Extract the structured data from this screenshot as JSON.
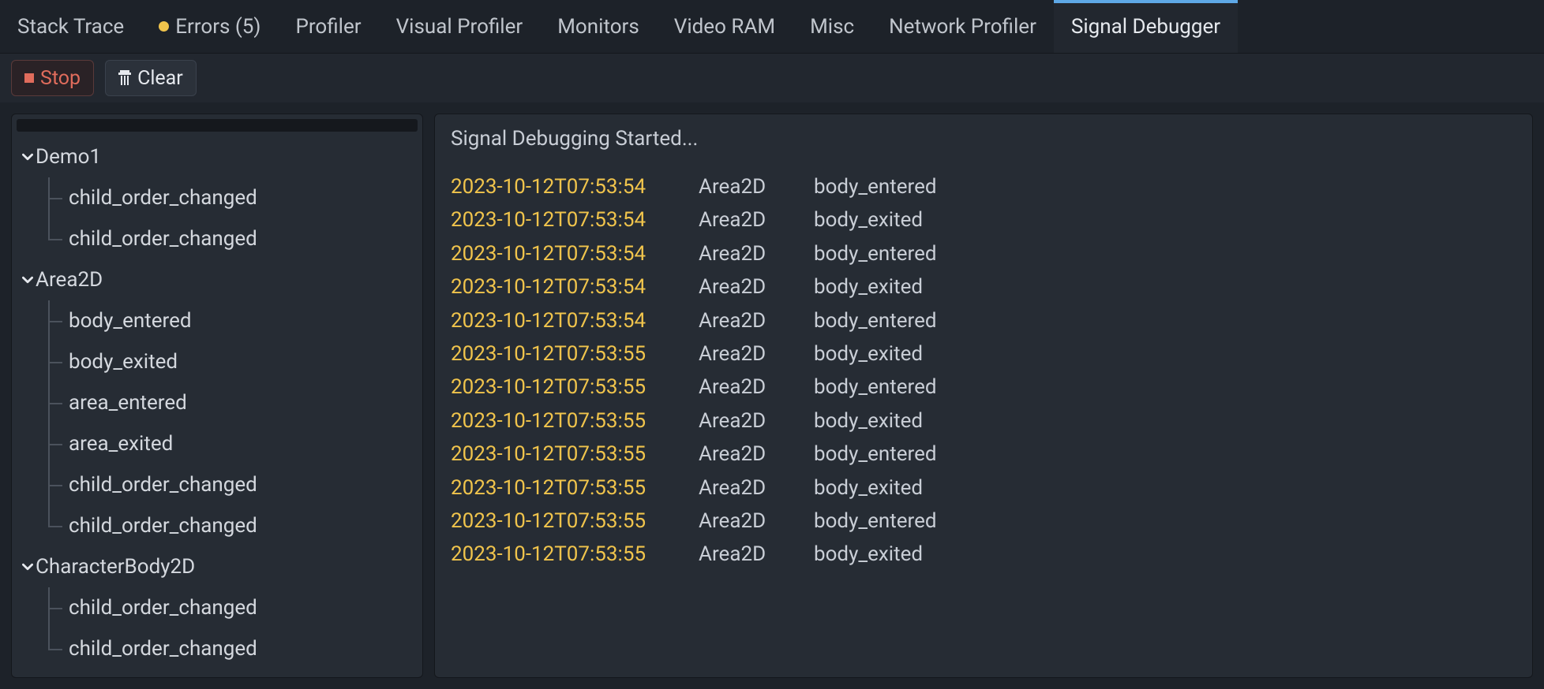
{
  "tabs": [
    {
      "label": "Stack Trace",
      "has_dot": false,
      "active": false
    },
    {
      "label": "Errors (5)",
      "has_dot": true,
      "active": false
    },
    {
      "label": "Profiler",
      "has_dot": false,
      "active": false
    },
    {
      "label": "Visual Profiler",
      "has_dot": false,
      "active": false
    },
    {
      "label": "Monitors",
      "has_dot": false,
      "active": false
    },
    {
      "label": "Video RAM",
      "has_dot": false,
      "active": false
    },
    {
      "label": "Misc",
      "has_dot": false,
      "active": false
    },
    {
      "label": "Network Profiler",
      "has_dot": false,
      "active": false
    },
    {
      "label": "Signal Debugger",
      "has_dot": false,
      "active": true
    }
  ],
  "toolbar": {
    "stop_label": "Stop",
    "clear_label": "Clear"
  },
  "tree": [
    {
      "label": "Demo1",
      "expanded": true,
      "children": [
        {
          "label": "child_order_changed"
        },
        {
          "label": "child_order_changed"
        }
      ]
    },
    {
      "label": "Area2D",
      "expanded": true,
      "children": [
        {
          "label": "body_entered"
        },
        {
          "label": "body_exited"
        },
        {
          "label": "area_entered"
        },
        {
          "label": "area_exited"
        },
        {
          "label": "child_order_changed"
        },
        {
          "label": "child_order_changed"
        }
      ]
    },
    {
      "label": "CharacterBody2D",
      "expanded": true,
      "children": [
        {
          "label": "child_order_changed"
        },
        {
          "label": "child_order_changed"
        }
      ]
    }
  ],
  "log": {
    "title": "Signal Debugging Started...",
    "rows": [
      {
        "ts": "2023-10-12T07:53:54",
        "src": "Area2D",
        "sig": "body_entered"
      },
      {
        "ts": "2023-10-12T07:53:54",
        "src": "Area2D",
        "sig": "body_exited"
      },
      {
        "ts": "2023-10-12T07:53:54",
        "src": "Area2D",
        "sig": "body_entered"
      },
      {
        "ts": "2023-10-12T07:53:54",
        "src": "Area2D",
        "sig": "body_exited"
      },
      {
        "ts": "2023-10-12T07:53:54",
        "src": "Area2D",
        "sig": "body_entered"
      },
      {
        "ts": "2023-10-12T07:53:55",
        "src": "Area2D",
        "sig": "body_exited"
      },
      {
        "ts": "2023-10-12T07:53:55",
        "src": "Area2D",
        "sig": "body_entered"
      },
      {
        "ts": "2023-10-12T07:53:55",
        "src": "Area2D",
        "sig": "body_exited"
      },
      {
        "ts": "2023-10-12T07:53:55",
        "src": "Area2D",
        "sig": "body_entered"
      },
      {
        "ts": "2023-10-12T07:53:55",
        "src": "Area2D",
        "sig": "body_exited"
      },
      {
        "ts": "2023-10-12T07:53:55",
        "src": "Area2D",
        "sig": "body_entered"
      },
      {
        "ts": "2023-10-12T07:53:55",
        "src": "Area2D",
        "sig": "body_exited"
      }
    ]
  },
  "colors": {
    "accent": "#5ea8e6",
    "timestamp": "#f0c44c",
    "danger": "#e06c5c"
  }
}
